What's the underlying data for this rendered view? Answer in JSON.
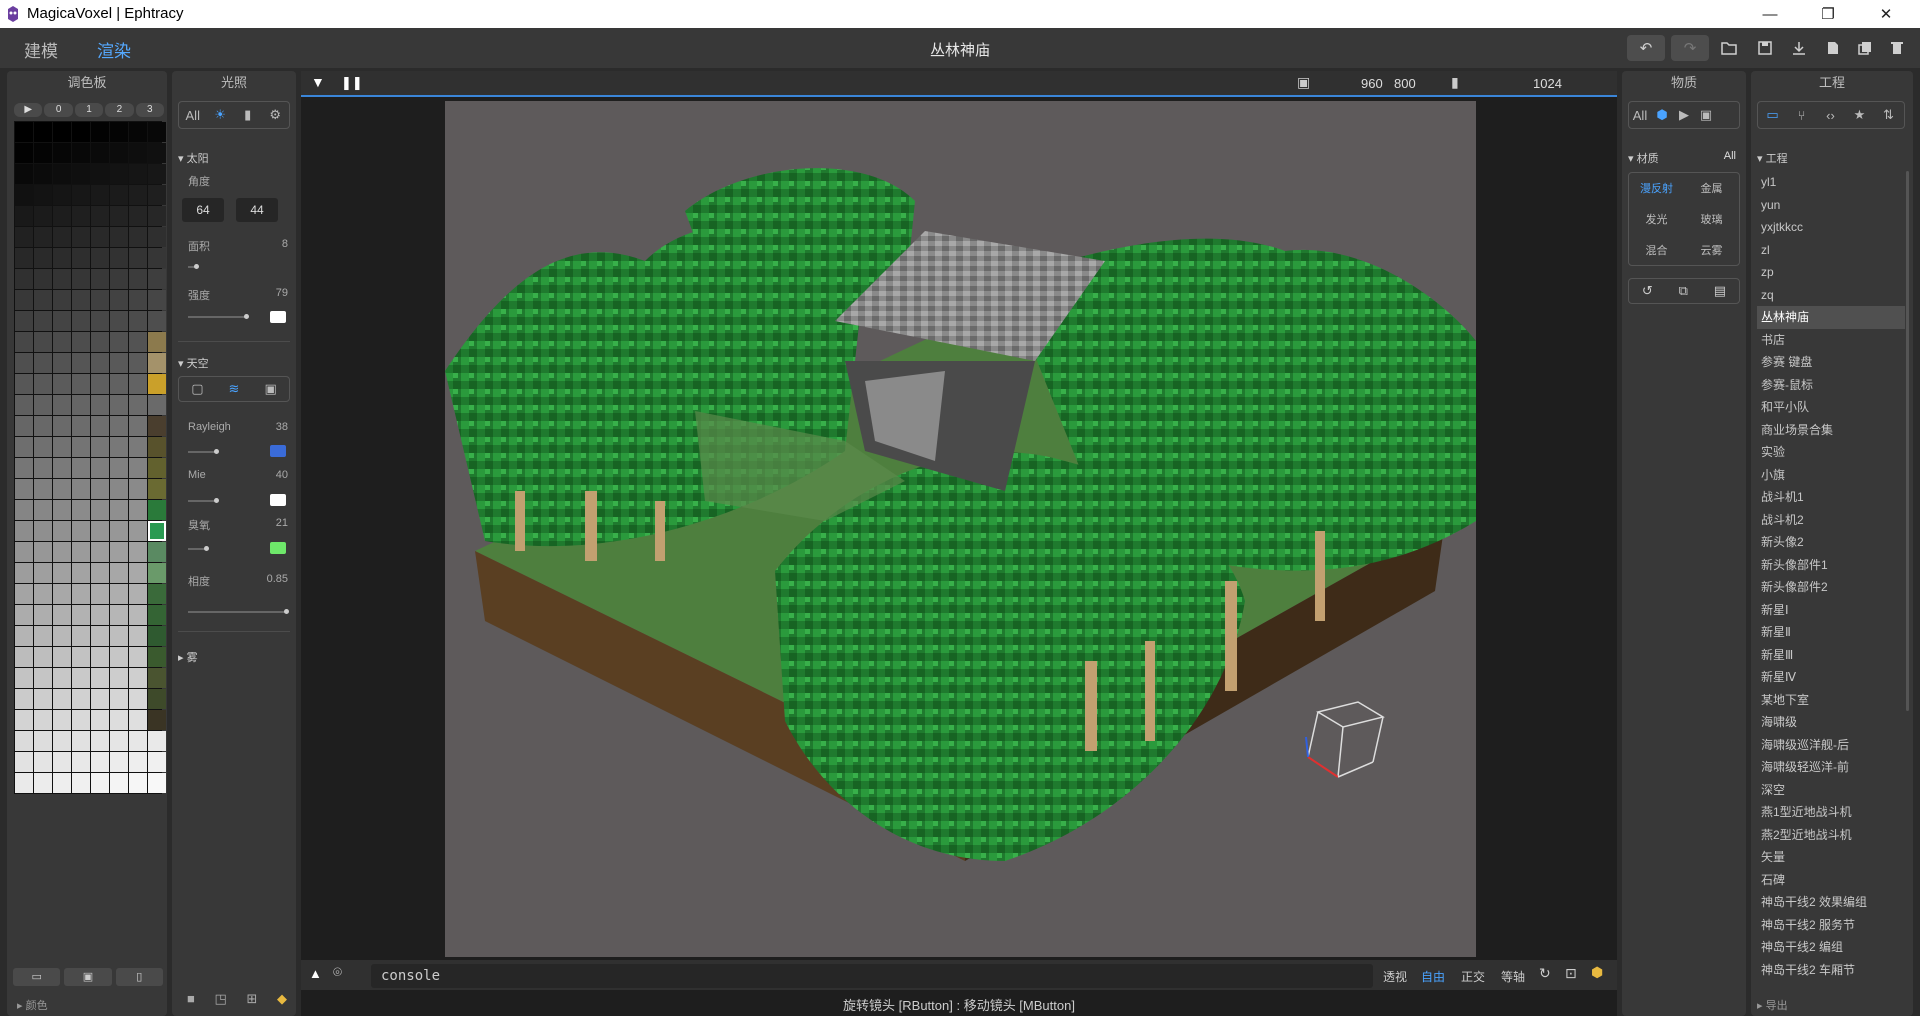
{
  "window": {
    "title": "MagicaVoxel | Ephtracy",
    "min": "—",
    "restore": "❐",
    "close": "✕"
  },
  "appbar": {
    "tab_model": "建模",
    "tab_render": "渲染",
    "project_title": "丛林神庙"
  },
  "toolbar": {
    "undo": "↶",
    "redo": "↷",
    "open": "📂",
    "save": "💾",
    "export": "⤓",
    "new": "🗋",
    "copy": "⧉",
    "delete": "🗑"
  },
  "palette": {
    "title": "调色板",
    "tabs": [
      "▶",
      "0",
      "1",
      "2",
      "3"
    ],
    "bottom_label": "颜色",
    "accent_colors": [
      "#8c7a4d",
      "#a4926a",
      "#caa02a",
      "#6a6a6a",
      "#4a3e2e",
      "#58522c",
      "#62612e",
      "#6a6a32",
      "#2a7a3a",
      "#2a9a52",
      "#5a8a62",
      "#6a9a6a",
      "#3a6a3a",
      "#346434",
      "#2f5a30",
      "#3a5a2e",
      "#4a5430",
      "#3e4a2a",
      "#3a3424"
    ]
  },
  "lighting": {
    "title": "光照",
    "filter_all": "All",
    "sun_section": "太阳",
    "angle_label": "角度",
    "angle_values": [
      "64",
      "44"
    ],
    "area_label": "面积",
    "area_value": "8",
    "intensity_label": "强度",
    "intensity_value": "79",
    "sky_section": "天空",
    "rayleigh_label": "Rayleigh",
    "rayleigh_value": "38",
    "mie_label": "Mie",
    "mie_value": "40",
    "ozone_label": "臭氧",
    "ozone_value": "21",
    "phase_label": "相度",
    "phase_value": "0.85",
    "fog_section": "雾",
    "colors": {
      "sun": "#ffffff",
      "rayleigh": "#3a6bd8",
      "mie": "#ffffff",
      "ozone": "#6ee76a"
    }
  },
  "viewport": {
    "width": "960",
    "height": "800",
    "samples": "1024",
    "console": "console",
    "views": [
      "透视",
      "自由",
      "正交",
      "等轴"
    ],
    "active_view": "自由",
    "hint": "旋转镜头 [RButton] : 移动镜头 [MButton]"
  },
  "material": {
    "title": "物质",
    "filter_all": "All",
    "section": "材质",
    "section_all": "All",
    "types": [
      "漫反射",
      "金属",
      "发光",
      "玻璃",
      "混合",
      "云雾"
    ]
  },
  "project": {
    "title": "工程",
    "section": "工程",
    "items": [
      "yl1",
      "yun",
      "yxjtkkcc",
      "zl",
      "zp",
      "zq",
      "丛林神庙",
      "书店",
      "参赛 键盘",
      "参赛-鼠标",
      "和平小队",
      "商业场景合集",
      "实验",
      "小旗",
      "战斗机1",
      "战斗机2",
      "新头像2",
      "新头像部件1",
      "新头像部件2",
      "新星Ⅰ",
      "新星Ⅱ",
      "新星Ⅲ",
      "新星Ⅳ",
      "某地下室",
      "海啸级",
      "海啸级巡洋舰-后",
      "海啸级轻巡洋-前",
      "深空",
      "燕1型近地战斗机",
      "燕2型近地战斗机",
      "矢量",
      "石碑",
      "神岛干线2 效果编组",
      "神岛干线2 服务节",
      "神岛干线2 编组",
      "神岛干线2 车厢节"
    ],
    "active": "丛林神庙",
    "export_label": "导出"
  }
}
